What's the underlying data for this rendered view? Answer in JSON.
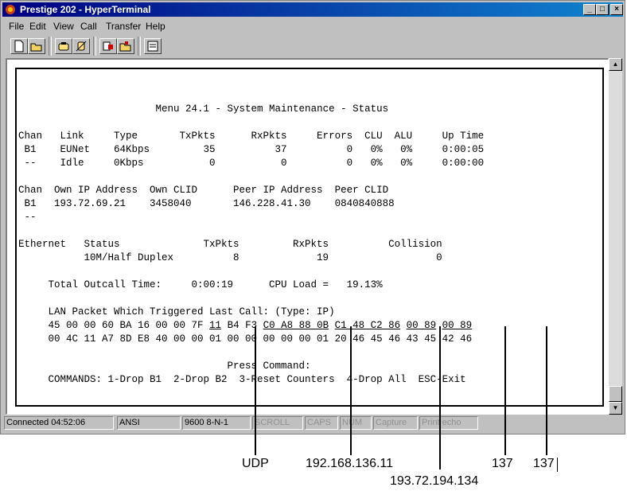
{
  "window": {
    "title": "Prestige 202 - HyperTerminal",
    "controls": [
      "_",
      "□",
      "×"
    ]
  },
  "menu": [
    "File",
    "Edit",
    "View",
    "Call",
    "Transfer",
    "Help"
  ],
  "toolbar": {
    "buttons": [
      "new-icon",
      "open-icon",
      "connect-icon",
      "disconnect-icon",
      "send-icon",
      "receive-icon",
      "properties-icon"
    ]
  },
  "terminal": {
    "menu_title": "Menu 24.1 - System Maintenance - Status",
    "chan_header": "Chan   Link     Type       TxPkts      RxPkts     Errors  CLU  ALU     Up Time",
    "chan_rows": [
      " B1    EUNet    64Kbps         35          37          0   0%   0%     0:00:05",
      " --    Idle     0Kbps           0           0          0   0%   0%     0:00:00"
    ],
    "ip_header": "Chan  Own IP Address  Own CLID      Peer IP Address  Peer CLID",
    "ip_rows": [
      " B1   193.72.69.21    3458040       146.228.41.30    0840840888",
      " --"
    ],
    "eth_header": "Ethernet   Status              TxPkts         RxPkts          Collision",
    "eth_row": "           10M/Half Duplex          8             19                  0",
    "outcall_line": "     Total Outcall Time:     0:00:19      CPU Load =   19.13%",
    "lan_title": "     LAN Packet Which Triggered Last Call: (Type: IP)",
    "hex_line1_segments": [
      {
        "text": "     45 00 00 60 BA 16 00 00 7F ",
        "u": false
      },
      {
        "text": "11",
        "u": true
      },
      {
        "text": " B4 F3 ",
        "u": false
      },
      {
        "text": "C0 A8 88 0B",
        "u": true
      },
      {
        "text": " ",
        "u": false
      },
      {
        "text": "C1 48 C2 86",
        "u": true
      },
      {
        "text": " ",
        "u": false
      },
      {
        "text": "00 89",
        "u": true
      },
      {
        "text": " ",
        "u": false
      },
      {
        "text": "00 89",
        "u": true
      }
    ],
    "hex_line2": "     00 4C 11 A7 8D E8 40 00 00 01 00 00 00 00 00 01 20 46 45 46 43 45 42 46",
    "press_command": "                                   Press Command:",
    "commands": "     COMMANDS: 1-Drop B1  2-Drop B2  3-Reset Counters  4-Drop All  ESC-Exit"
  },
  "status": {
    "connected": "Connected 04:52:06",
    "emulation": "ANSI",
    "settings": "9600 8-N-1",
    "scroll": "SCROLL",
    "caps": "CAPS",
    "num": "NUM",
    "capture": "Capture",
    "printecho": "Print echo"
  },
  "annotations": {
    "udp": "UDP",
    "src_ip": "192.168.136.11",
    "dst_ip": "193.72.194.134",
    "port1": "137",
    "port2": "137"
  }
}
